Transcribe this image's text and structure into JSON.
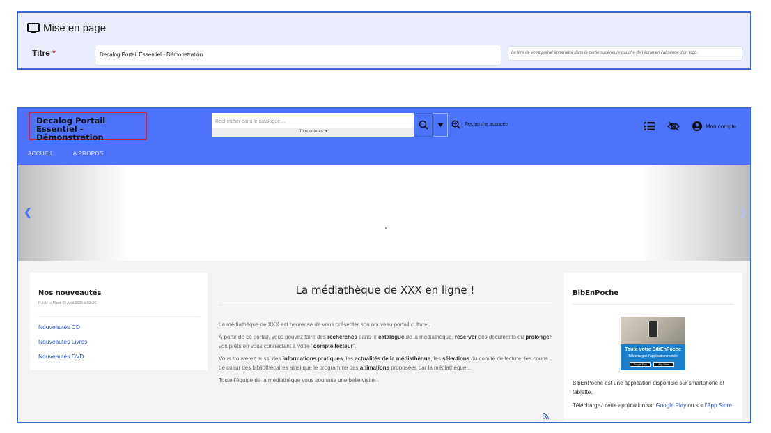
{
  "settings": {
    "section_title": "Mise en page",
    "titre_label": "Titre",
    "required_mark": "*",
    "titre_value": "Decalog Portail Essentiel - Démonstration",
    "titre_hint": "Le titre de votre portail apparaîtra dans la partie supérieure gauche de l'écran en l'absence d'un logo."
  },
  "portal": {
    "site_title": "Decalog Portail Essentiel - Démonstration",
    "search": {
      "placeholder": "Rechercher dans le catalogue ...",
      "criteria": "Tous critères"
    },
    "advanced_search": "Recherche avancée",
    "account_label": "Mon compte",
    "nav": [
      "ACCUEIL",
      "A PROPOS"
    ],
    "colors": {
      "header": "#4d73fb",
      "highlight": "#d0203a",
      "link": "#2f55cc"
    },
    "news": {
      "title": "Nos nouveautés",
      "published": "Publié le Mardi 05 Août 2025 à 09h20",
      "links": [
        "Nouveautés CD",
        "Nouveautés Livres",
        "Nouveautés DVD"
      ]
    },
    "center": {
      "title": "La médiathèque de XXX en ligne !",
      "p1": "La médiathèque de XXX est heureuse de vous présenter son nouveau portail culturel.",
      "p2": {
        "a": "À partir de ce portail, vous pouvez faire des ",
        "b": "recherches",
        "c": " dans le ",
        "d": "catalogue",
        "e": " de la médiathèque, ",
        "f": "réserver",
        "g": " des documents ou ",
        "h": "prolonger",
        "i": " vos prêts en vous connectant à votre \"",
        "j": "compte lecteur",
        "k": "\"."
      },
      "p3": {
        "a": "Vous trouverez aussi des ",
        "b": "informations pratiques",
        "c": ", les ",
        "d": "actualités de la médiathèque",
        "e": ", les ",
        "f": "sélections",
        "g": " du comité de lecture, les coups de coeur des bibliothécaires ainsi que le programme des ",
        "h": "animations",
        "i": " proposées par la médiathèque..."
      },
      "p4": "Toute l'équipe de la médiathèque vous souhaite une belle visite !"
    },
    "bibenpoche": {
      "title": "BibEnPoche",
      "img_title": "Toute votre BibEnPoche",
      "img_sub": "Téléchargez l'application mobile",
      "badge1": "Google Play",
      "badge2": "App Store",
      "text1": "BibEnPoche est une application disponible sur smartphone et tablette.",
      "text2_a": "Téléchargez cette application sur ",
      "text2_link1": "Google Play",
      "text2_b": " ou sur ",
      "text2_link2": "l'App Store"
    }
  }
}
